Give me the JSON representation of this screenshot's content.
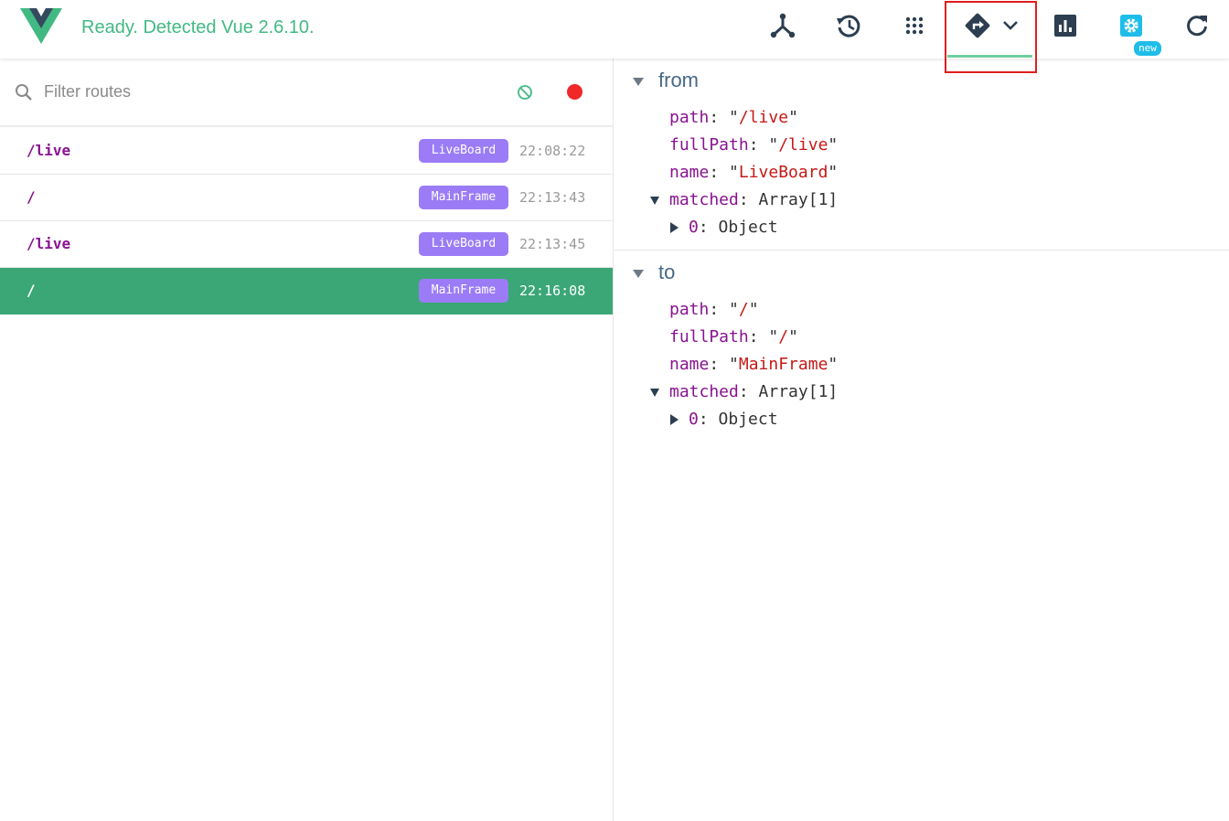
{
  "header": {
    "status": "Ready. Detected Vue 2.6.10.",
    "new_badge": "new",
    "accent_color": "#42b983",
    "buttons": [
      {
        "name": "components-icon"
      },
      {
        "name": "history-icon"
      },
      {
        "name": "events-icon"
      },
      {
        "name": "router-icon"
      },
      {
        "name": "chevron-down-icon"
      },
      {
        "name": "performance-icon"
      },
      {
        "name": "settings-icon"
      },
      {
        "name": "refresh-icon"
      }
    ]
  },
  "filter": {
    "placeholder": "Filter routes",
    "value": ""
  },
  "routes": [
    {
      "path": "/live",
      "name": "LiveBoard",
      "time": "22:08:22",
      "selected": false
    },
    {
      "path": "/",
      "name": "MainFrame",
      "time": "22:13:43",
      "selected": false
    },
    {
      "path": "/live",
      "name": "LiveBoard",
      "time": "22:13:45",
      "selected": false
    },
    {
      "path": "/",
      "name": "MainFrame",
      "time": "22:16:08",
      "selected": true
    }
  ],
  "detail": {
    "from": {
      "title": "from",
      "path_key": "path",
      "path_val": "/live",
      "fullpath_key": "fullPath",
      "fullpath_val": "/live",
      "name_key": "name",
      "name_val": "LiveBoard",
      "matched_key": "matched",
      "matched_val": "Array[1]",
      "item_key": "0",
      "item_val": "Object"
    },
    "to": {
      "title": "to",
      "path_key": "path",
      "path_val": "/",
      "fullpath_key": "fullPath",
      "fullpath_val": "/",
      "name_key": "name",
      "name_val": "MainFrame",
      "matched_key": "matched",
      "matched_val": "Array[1]",
      "item_key": "0",
      "item_val": "Object"
    }
  }
}
